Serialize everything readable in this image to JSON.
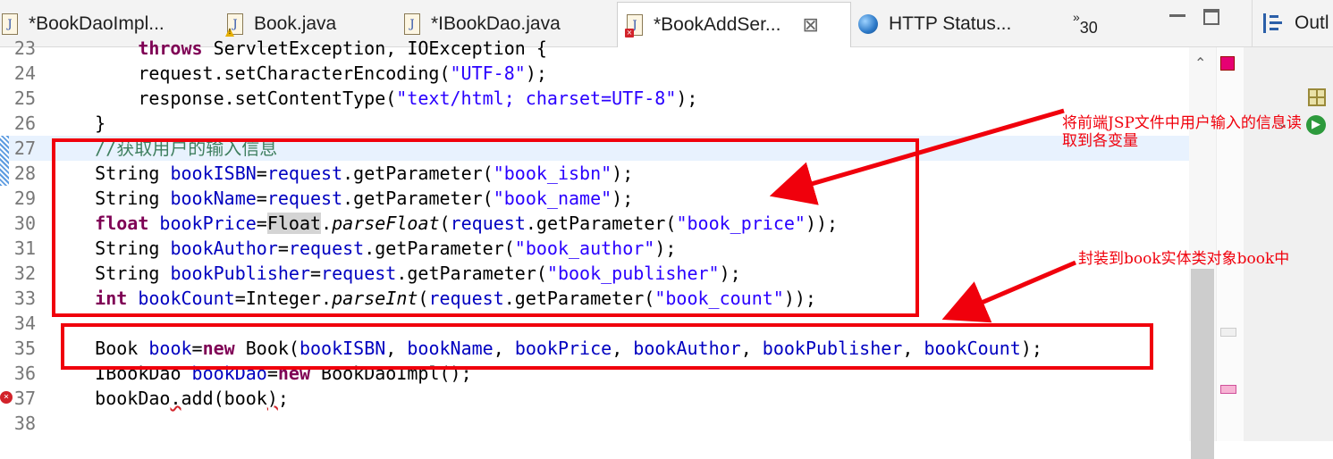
{
  "tabs": [
    {
      "label": "*BookDaoImpl...",
      "icon": "java-file-icon",
      "mark": ""
    },
    {
      "label": "Book.java",
      "icon": "java-file-warning-icon",
      "mark": "warn"
    },
    {
      "label": "*IBookDao.java",
      "icon": "java-file-icon",
      "mark": ""
    },
    {
      "label": "*BookAddSer...",
      "icon": "java-file-error-icon",
      "mark": "err",
      "active": true
    },
    {
      "label": "HTTP Status...",
      "icon": "globe-icon",
      "mark": ""
    }
  ],
  "overflow": {
    "glyph": "»",
    "count": "30"
  },
  "outline_tab": {
    "label": "Outl"
  },
  "code_lines": [
    {
      "n": "23",
      "html": "<span class=\"kw\">throws</span> ServletException, IOException {",
      "indent": 8
    },
    {
      "n": "24",
      "html": "request.setCharacterEncoding(<span class=\"str\">\"UTF-8\"</span>);",
      "indent": 8
    },
    {
      "n": "25",
      "html": "response.setContentType(<span class=\"str\">\"text/html; charset=UTF-8\"</span>);",
      "indent": 8
    },
    {
      "n": "26",
      "html": "}",
      "indent": 4
    },
    {
      "n": "27",
      "html": "<span class=\"cm\">//获取用户的输入信息</span>",
      "indent": 4,
      "highlight": true
    },
    {
      "n": "28",
      "html": "String <span class=\"var\">bookISBN</span>=<span class=\"var\">request</span>.getParameter(<span class=\"str\">\"book_isbn\"</span>);",
      "indent": 4
    },
    {
      "n": "29",
      "html": "String <span class=\"var\">bookName</span>=<span class=\"var\">request</span>.getParameter(<span class=\"str\">\"book_name\"</span>);",
      "indent": 4
    },
    {
      "n": "30",
      "html": "<span class=\"kw\">float</span> <span class=\"var\">bookPrice</span>=<span class=\"sel\">Float</span>.<span class=\"it\">parseFloat</span>(<span class=\"var\">request</span>.getParameter(<span class=\"str\">\"book_price\"</span>));",
      "indent": 4
    },
    {
      "n": "31",
      "html": "String <span class=\"var\">bookAuthor</span>=<span class=\"var\">request</span>.getParameter(<span class=\"str\">\"book_author\"</span>);",
      "indent": 4
    },
    {
      "n": "32",
      "html": "String <span class=\"var\">bookPublisher</span>=<span class=\"var\">request</span>.getParameter(<span class=\"str\">\"book_publisher\"</span>);",
      "indent": 4
    },
    {
      "n": "33",
      "html": "<span class=\"kw\">int</span> <span class=\"var\">bookCount</span>=Integer.<span class=\"it\">parseInt</span>(<span class=\"var\">request</span>.getParameter(<span class=\"str\">\"book_count\"</span>));",
      "indent": 4
    },
    {
      "n": "34",
      "html": "",
      "indent": 4
    },
    {
      "n": "35",
      "html": "Book <span class=\"var\">book</span>=<span class=\"kw\">new</span> Book(<span class=\"var\">bookISBN</span>, <span class=\"var\">bookName</span>, <span class=\"var\">bookPrice</span>, <span class=\"var\">bookAuthor</span>, <span class=\"var\">bookPublisher</span>, <span class=\"var\">bookCount</span>);",
      "indent": 4
    },
    {
      "n": "36",
      "html": "IBookDao <span class=\"var\">bookDao</span>=<span class=\"kw\">new</span> BookDaoImpl();",
      "indent": 4
    },
    {
      "n": "37",
      "html": "bookDao<span class=\"squig\">.</span>add(book<span class=\"squig\">)</span>;",
      "indent": 4,
      "error": true
    },
    {
      "n": "38",
      "html": "",
      "indent": 4
    }
  ],
  "annotations": {
    "note1": "将前端JSP文件中用户输入的信息读取到各变量",
    "note2": "封装到book实体类对象book中"
  },
  "colors": {
    "annotation_red": "#f0000c",
    "keyword": "#7f0055",
    "string": "#2a00ff",
    "field": "#0000c0"
  }
}
